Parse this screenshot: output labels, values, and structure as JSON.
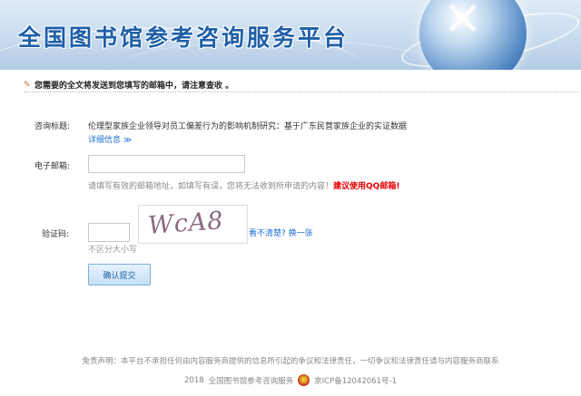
{
  "banner": {
    "title": "全国图书馆参考咨询服务平台"
  },
  "notice": {
    "message": "您需要的全文将发送到您填写的邮箱中，请注意查收 。"
  },
  "form": {
    "topic_label": "咨询标题:",
    "topic_value": "伦理型家族企业领导对员工偏差行为的影响机制研究：基于广东民营家族企业的实证数据",
    "detail_link": "详细信息 ≫",
    "email_label": "电子邮箱:",
    "email_value": "",
    "email_hint": "请填写有效的邮箱地址，如填写有误，您将无法收到所申请的内容！",
    "email_hint_emphasis": "建议使用QQ邮箱!",
    "captcha_label": "验证码:",
    "captcha_value": "",
    "captcha_text": "WcA8",
    "refresh_link": "看不清楚? 换一张",
    "case_hint": "不区分大小写",
    "submit_label": "确认提交"
  },
  "footer": {
    "disclaimer": "免责声明：本平台不承担任何由内容服务商提供的信息所引起的争议和法律责任，一切争议和法律责任请与内容服务商联系",
    "copyright_year": "2018",
    "copyright_name": "全国图书馆参考咨询服务",
    "icp": "京ICP备12042061号-1"
  }
}
